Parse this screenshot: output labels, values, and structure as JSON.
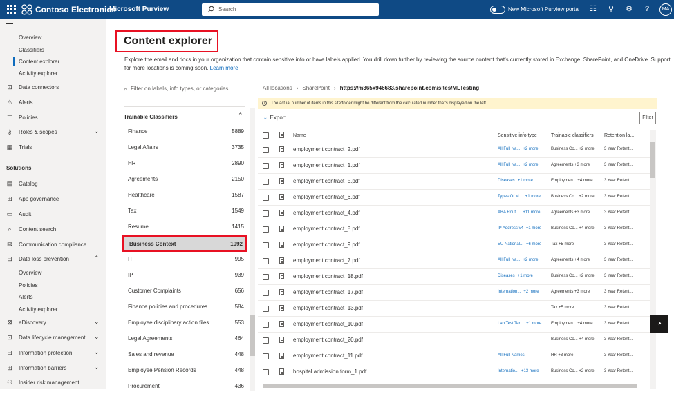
{
  "topbar": {
    "org_name": "Contoso Electronics",
    "app_name": "Microsoft Purview",
    "search_placeholder": "Search",
    "toggle_label": "New Microsoft Purview portal",
    "avatar_initials": "MA",
    "accent": "#0f4a85"
  },
  "nav": {
    "items": [
      {
        "label": "Overview"
      },
      {
        "label": "Classifiers"
      },
      {
        "label": "Content explorer"
      },
      {
        "label": "Activity explorer"
      },
      {
        "label": "Data connectors"
      },
      {
        "label": "Alerts"
      },
      {
        "label": "Policies"
      },
      {
        "label": "Roles & scopes"
      },
      {
        "label": "Trials"
      }
    ],
    "solutions_header": "Solutions",
    "solutions": [
      {
        "label": "Catalog"
      },
      {
        "label": "App governance"
      },
      {
        "label": "Audit"
      },
      {
        "label": "Content search"
      },
      {
        "label": "Communication compliance"
      },
      {
        "label": "Data loss prevention"
      },
      {
        "label": "Overview"
      },
      {
        "label": "Policies"
      },
      {
        "label": "Alerts"
      },
      {
        "label": "Activity explorer"
      },
      {
        "label": "eDiscovery"
      },
      {
        "label": "Data lifecycle management"
      },
      {
        "label": "Information protection"
      },
      {
        "label": "Information barriers"
      },
      {
        "label": "Insider risk management"
      }
    ]
  },
  "page": {
    "title": "Content explorer",
    "description": "Explore the email and docs in your organization that contain sensitive info or have labels applied. You drill down further by reviewing the source content that's currently stored in Exchange, SharePoint, and OneDrive. Support for more locations is coming soon.",
    "learn_more": "Learn more"
  },
  "filter_panel": {
    "search_placeholder": "Filter on labels, info types, or categories",
    "section_title": "Trainable Classifiers",
    "classifiers": [
      {
        "name": "Finance",
        "count": "5889"
      },
      {
        "name": "Legal Affairs",
        "count": "3735"
      },
      {
        "name": "HR",
        "count": "2890"
      },
      {
        "name": "Agreements",
        "count": "2150"
      },
      {
        "name": "Healthcare",
        "count": "1587"
      },
      {
        "name": "Tax",
        "count": "1549"
      },
      {
        "name": "Resume",
        "count": "1415"
      },
      {
        "name": "Business Context",
        "count": "1092"
      },
      {
        "name": "IT",
        "count": "995"
      },
      {
        "name": "IP",
        "count": "939"
      },
      {
        "name": "Customer Complaints",
        "count": "656"
      },
      {
        "name": "Finance policies and procedures",
        "count": "584"
      },
      {
        "name": "Employee disciplinary action files",
        "count": "553"
      },
      {
        "name": "Legal Agreements",
        "count": "464"
      },
      {
        "name": "Sales and revenue",
        "count": "448"
      },
      {
        "name": "Employee Pension Records",
        "count": "448"
      },
      {
        "name": "Procurement",
        "count": "436"
      }
    ]
  },
  "breadcrumb": {
    "items": [
      "All locations",
      "SharePoint",
      "https://m365x946683.sharepoint.com/sites/MLTesting"
    ]
  },
  "banner": {
    "text": "The actual number of items in this site/folder might be different from the calculated number that's displayed on the left"
  },
  "toolbar": {
    "export_label": "Export",
    "filter_label": "Filter"
  },
  "table": {
    "columns": [
      "Name",
      "Sensitive info type",
      "Trainable classifiers",
      "Retention la..."
    ],
    "rows": [
      {
        "name": "employment contract_2.pdf",
        "sit": "All Full Na...",
        "sit_more": "+2 more",
        "tc": "Business Co... +2 more",
        "ret": "3 Year Retent..."
      },
      {
        "name": "employment contract_1.pdf",
        "sit": "All Full Na...",
        "sit_more": "+2 more",
        "tc": "Agreements +3 more",
        "ret": "3 Year Retent..."
      },
      {
        "name": "employment contract_5.pdf",
        "sit": "Diseases",
        "sit_more": "+1 more",
        "tc": "Employmen... +4 more",
        "ret": "3 Year Retent..."
      },
      {
        "name": "employment contract_6.pdf",
        "sit": "Types Of M...",
        "sit_more": "+1 more",
        "tc": "Business Co... +2 more",
        "ret": "3 Year Retent..."
      },
      {
        "name": "employment contract_4.pdf",
        "sit": "ABA Routi...",
        "sit_more": "+11 more",
        "tc": "Agreements +3 more",
        "ret": "3 Year Retent..."
      },
      {
        "name": "employment contract_8.pdf",
        "sit": "IP Address v4",
        "sit_more": "+1 more",
        "tc": "Business Co... +4 more",
        "ret": "3 Year Retent..."
      },
      {
        "name": "employment contract_9.pdf",
        "sit": "EU National...",
        "sit_more": "+6 more",
        "tc": "Tax +5 more",
        "ret": "3 Year Retent..."
      },
      {
        "name": "employment contract_7.pdf",
        "sit": "All Full Na...",
        "sit_more": "+2 more",
        "tc": "Agreements +4 more",
        "ret": "3 Year Retent..."
      },
      {
        "name": "employment contract_18.pdf",
        "sit": "Diseases",
        "sit_more": "+1 more",
        "tc": "Business Co... +2 more",
        "ret": "3 Year Retent..."
      },
      {
        "name": "employment contract_17.pdf",
        "sit": "Internation...",
        "sit_more": "+2 more",
        "tc": "Agreements +3 more",
        "ret": "3 Year Retent..."
      },
      {
        "name": "employment contract_13.pdf",
        "sit": "",
        "sit_more": "",
        "tc": "Tax +5 more",
        "ret": "3 Year Retent..."
      },
      {
        "name": "employment contract_10.pdf",
        "sit": "Lab Test Ter...",
        "sit_more": "+1 more",
        "tc": "Employmen... +4 more",
        "ret": "3 Year Retent..."
      },
      {
        "name": "employment contract_20.pdf",
        "sit": "",
        "sit_more": "",
        "tc": "Business Co... +4 more",
        "ret": "3 Year Retent..."
      },
      {
        "name": "employment contract_11.pdf",
        "sit": "All Full Names",
        "sit_more": "",
        "tc": "HR +3 more",
        "ret": "3 Year Retent..."
      },
      {
        "name": "hospital admission form_1.pdf",
        "sit": "Internatio...",
        "sit_more": "+13 more",
        "tc": "Business Co... +2 more",
        "ret": "3 Year Retent..."
      }
    ]
  }
}
